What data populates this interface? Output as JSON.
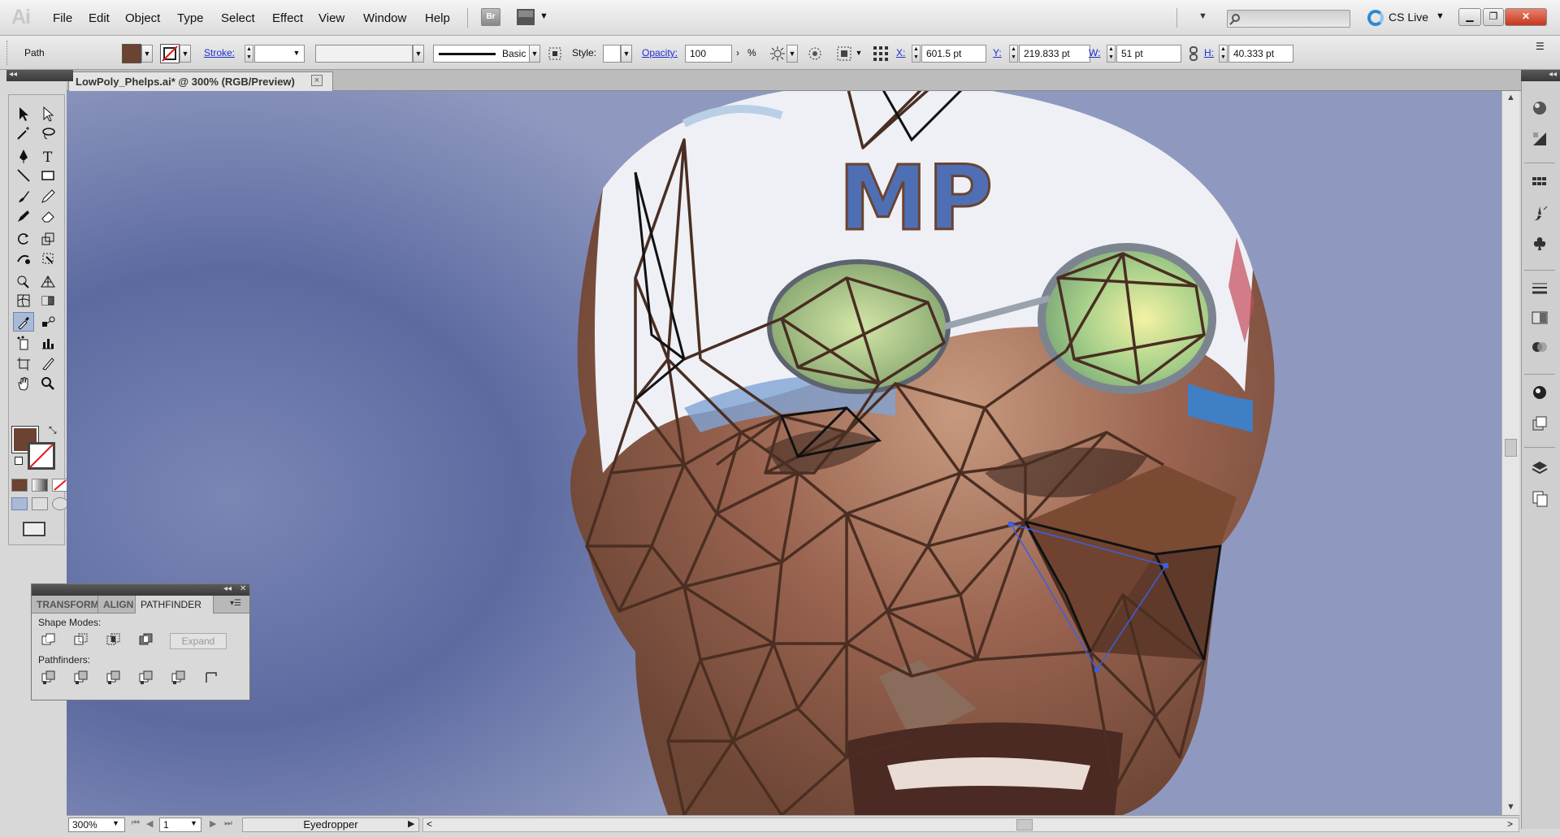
{
  "app": {
    "logo": "Ai",
    "menu": [
      "File",
      "Edit",
      "Object",
      "Type",
      "Select",
      "Effect",
      "View",
      "Window",
      "Help"
    ],
    "bridge_label": "Br",
    "cs_live_label": "CS Live",
    "search_placeholder": ""
  },
  "control_bar": {
    "object_type": "Path",
    "fill_color": "#6b4331",
    "stroke_label": "Stroke:",
    "stroke_weight": "",
    "variable_width": "",
    "brush_label": "Basic",
    "style_label": "Style:",
    "opacity_label": "Opacity:",
    "opacity_value": "100",
    "opacity_unit": "%",
    "x_label": "X:",
    "x_value": "601.5 pt",
    "y_label": "Y:",
    "y_value": "219.833 pt",
    "w_label": "W:",
    "w_value": "51 pt",
    "h_label": "H:",
    "h_value": "40.333 pt"
  },
  "document": {
    "tab_title": "LowPoly_Phelps.ai* @ 300% (RGB/Preview)",
    "close_label": "×"
  },
  "tools": [
    "selection-tool",
    "direct-selection-tool",
    "magic-wand-tool",
    "lasso-tool",
    "pen-tool",
    "type-tool",
    "line-segment-tool",
    "rectangle-tool",
    "paintbrush-tool",
    "pencil-tool",
    "blob-brush-tool",
    "eraser-tool",
    "rotate-tool",
    "scale-tool",
    "warp-tool",
    "free-transform-tool",
    "shape-builder-tool",
    "perspective-grid-tool",
    "mesh-tool",
    "gradient-tool",
    "eyedropper-tool",
    "blend-tool",
    "symbol-sprayer-tool",
    "column-graph-tool",
    "artboard-tool",
    "slice-tool",
    "hand-tool",
    "zoom-tool"
  ],
  "colors": {
    "fill": "#6b4331",
    "stroke": "none"
  },
  "status_bar": {
    "zoom": "300%",
    "page": "1",
    "current_tool": "Eyedropper"
  },
  "pathfinder_panel": {
    "tabs": [
      "TRANSFORM",
      "ALIGN",
      "PATHFINDER"
    ],
    "active_tab": "PATHFINDER",
    "shape_modes_label": "Shape Modes:",
    "expand_label": "Expand",
    "pathfinders_label": "Pathfinders:"
  },
  "right_dock_panels": [
    "color-panel",
    "color-guide-panel",
    "swatches-panel",
    "brushes-panel",
    "symbols-panel",
    "stroke-panel",
    "gradient-panel",
    "transparency-panel",
    "appearance-panel",
    "graphic-styles-panel",
    "layers-panel",
    "artboards-panel"
  ],
  "canvas_artwork": {
    "cap_logo": "MP"
  }
}
